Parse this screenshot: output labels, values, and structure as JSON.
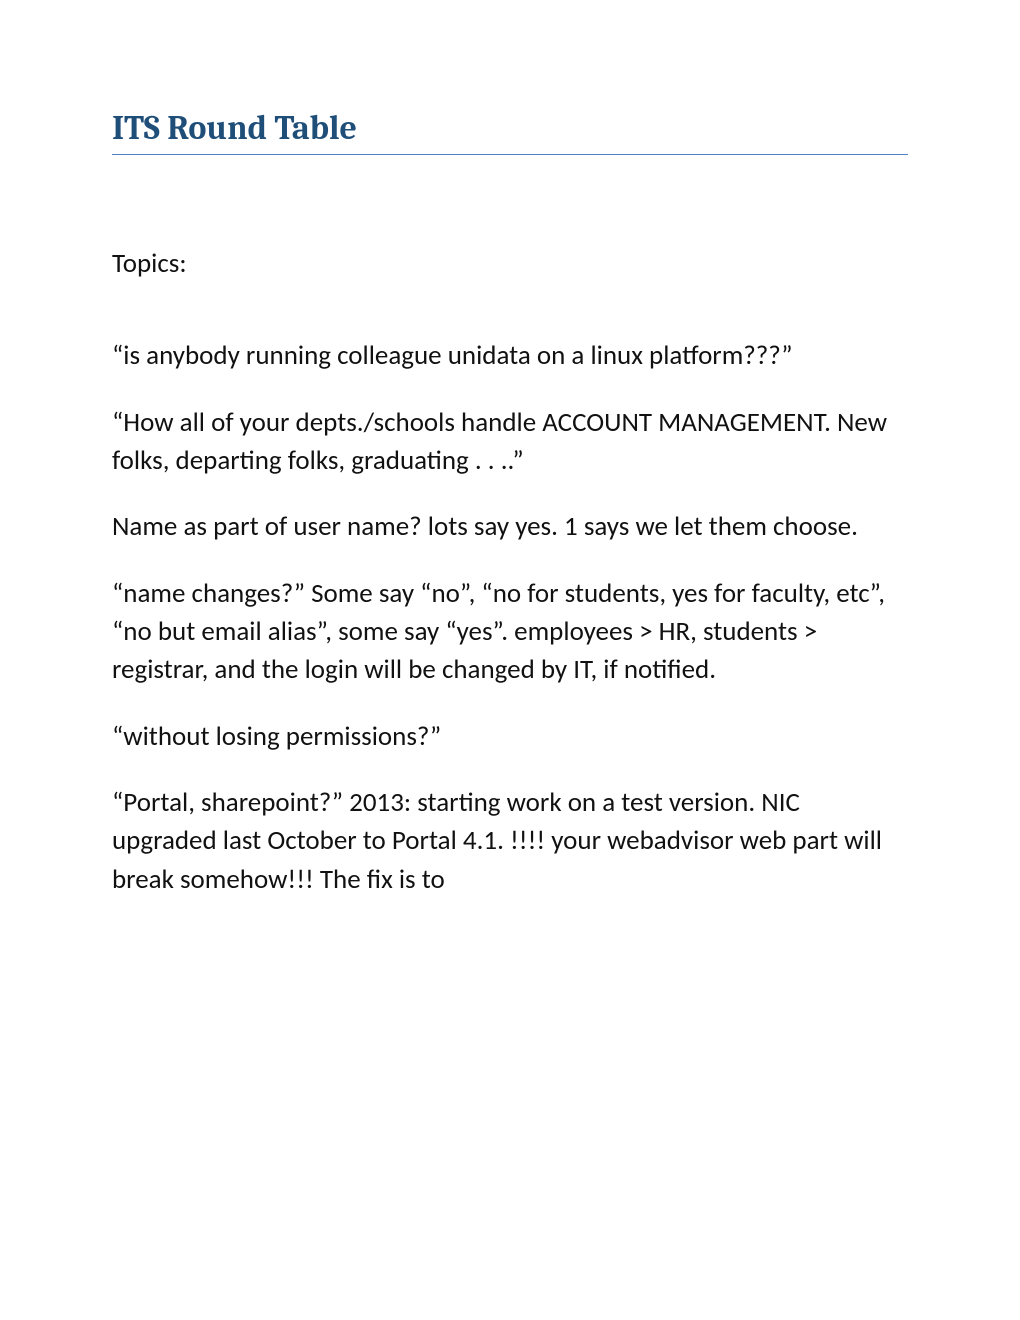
{
  "title": "ITS Round Table",
  "topics_label": "Topics:",
  "paragraphs": {
    "p1": "“is anybody running colleague unidata on a linux platform???”",
    "p2": "“How all of your depts./schools handle ACCOUNT MANAGEMENT. New folks, departing folks, graduating . . ..”",
    "p3": "Name as part of user name? lots say yes. 1 says we let them choose.",
    "p4": "“name changes?” Some say “no”, “no for students, yes for faculty, etc”, “no but email alias”, some say “yes”. employees > HR, students > registrar, and the login will be changed by IT, if notified.",
    "p5": "“without losing permissions?”",
    "p6": "“Portal, sharepoint?” 2013: starting work on a test version. NIC upgraded last October to Portal 4.1. !!!! your webadvisor web part will break somehow!!! The fix is to"
  }
}
